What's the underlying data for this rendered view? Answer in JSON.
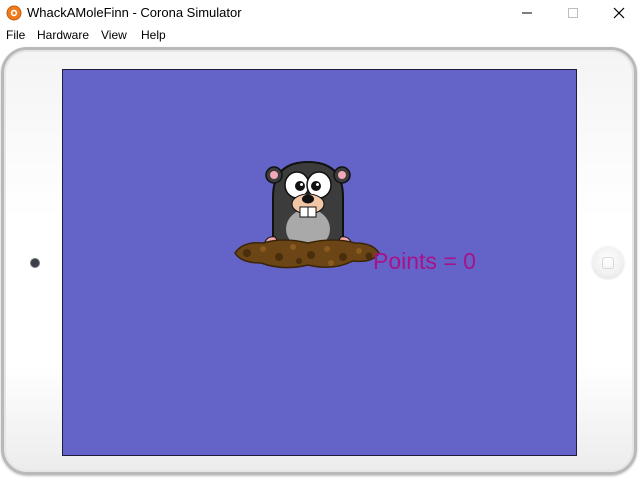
{
  "window": {
    "title": "WhackAMoleFinn - Corona Simulator",
    "controls": [
      "minimize",
      "maximize",
      "close"
    ]
  },
  "menubar": {
    "items": [
      "File",
      "Hardware",
      "View",
      "Help"
    ]
  },
  "game": {
    "score_text": "Points = 0",
    "background_color": "#6464c8",
    "score_color": "#a8118a"
  },
  "icons": {
    "app": "corona-simulator-icon",
    "mole": "mole-sprite"
  }
}
